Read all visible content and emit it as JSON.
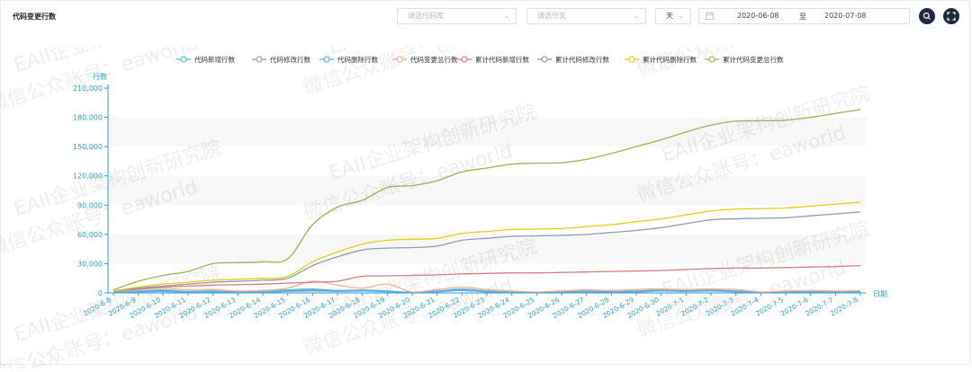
{
  "header": {
    "title": "代码变更行数",
    "repo_placeholder": "请选代码库",
    "branch_placeholder": "请选分支",
    "unit_value": "天",
    "date_start": "2020-06-08",
    "date_separator": "至",
    "date_end": "2020-07-08"
  },
  "colors": {
    "axis": "#2a9dd6",
    "grid_band": "#f7f7f7",
    "series": [
      "#44c7c9",
      "#9a8fd0",
      "#5ab1ef",
      "#f5b08c",
      "#d87a80",
      "#8d98b3",
      "#e5cf0d",
      "#97b552"
    ]
  },
  "chart_data": {
    "type": "line",
    "title": "",
    "xlabel": "日期",
    "ylabel": "行数",
    "ylim": [
      0,
      210000
    ],
    "yticks": [
      0,
      30000,
      60000,
      90000,
      120000,
      150000,
      180000,
      210000
    ],
    "ytick_labels": [
      "0",
      "30,000",
      "60,000",
      "90,000",
      "120,000",
      "150,000",
      "180,000",
      "210,000"
    ],
    "legend_position": "top",
    "grid": true,
    "categories": [
      "2020-6-8",
      "2020-6-9",
      "2020-6-10",
      "2020-6-11",
      "2020-6-12",
      "2020-6-13",
      "2020-6-14",
      "2020-6-15",
      "2020-6-16",
      "2020-6-17",
      "2020-6-18",
      "2020-6-19",
      "2020-6-20",
      "2020-6-21",
      "2020-6-22",
      "2020-6-23",
      "2020-6-24",
      "2020-6-25",
      "2020-6-26",
      "2020-6-27",
      "2020-6-28",
      "2020-6-29",
      "2020-6-30",
      "2020-7-1",
      "2020-7-2",
      "2020-7-3",
      "2020-7-4",
      "2020-7-5",
      "2020-7-6",
      "2020-7-7",
      "2020-7-8"
    ],
    "series": [
      {
        "name": "代码新增行数",
        "values": [
          1000,
          2000,
          3000,
          1500,
          2000,
          1000,
          1500,
          3000,
          4000,
          2500,
          3000,
          2000,
          500,
          2000,
          4000,
          2000,
          1000,
          500,
          1000,
          2000,
          1500,
          2000,
          3000,
          2500,
          3000,
          2000,
          500,
          1000,
          1500,
          1000,
          1500
        ]
      },
      {
        "name": "代码修改行数",
        "values": [
          500,
          1500,
          2000,
          1000,
          1500,
          1000,
          1000,
          2000,
          3000,
          2000,
          2500,
          1500,
          500,
          1500,
          3000,
          1500,
          800,
          300,
          800,
          1500,
          1200,
          1500,
          2500,
          2000,
          2500,
          1500,
          300,
          800,
          1200,
          800,
          1000
        ]
      },
      {
        "name": "代码删除行数",
        "values": [
          300,
          1000,
          1500,
          800,
          1000,
          500,
          800,
          1500,
          2000,
          1500,
          2000,
          1000,
          300,
          1000,
          2500,
          1000,
          500,
          200,
          500,
          1000,
          800,
          1000,
          2000,
          1500,
          2000,
          1000,
          200,
          500,
          800,
          500,
          800
        ]
      },
      {
        "name": "代码变更总行数",
        "values": [
          1500,
          3500,
          5000,
          3000,
          3500,
          2000,
          2500,
          5000,
          12000,
          8000,
          5000,
          9000,
          1000,
          3500,
          6000,
          3500,
          2000,
          1000,
          2000,
          3000,
          2500,
          3500,
          4000,
          3500,
          4000,
          3500,
          1000,
          2000,
          2500,
          2000,
          2500
        ]
      },
      {
        "name": "累计代码新增行数",
        "values": [
          2000,
          4000,
          6000,
          7000,
          8000,
          8500,
          9000,
          10000,
          11000,
          12000,
          17000,
          17500,
          18000,
          18500,
          19500,
          20000,
          20500,
          20500,
          21000,
          21500,
          22000,
          22500,
          23000,
          24000,
          25000,
          25500,
          25500,
          26000,
          26500,
          27000,
          28000
        ]
      },
      {
        "name": "累计代码修改行数",
        "values": [
          1500,
          5000,
          7000,
          9000,
          11000,
          12000,
          13000,
          15000,
          28000,
          37000,
          44000,
          46000,
          46500,
          48000,
          54000,
          56000,
          58000,
          58500,
          59000,
          60000,
          62000,
          64000,
          67000,
          71000,
          75000,
          76000,
          76500,
          77000,
          79000,
          81000,
          83000
        ]
      },
      {
        "name": "累计代码删除行数",
        "values": [
          2000,
          6000,
          9000,
          11000,
          13000,
          14000,
          15000,
          17000,
          32000,
          42000,
          50000,
          54000,
          55000,
          56000,
          61000,
          63000,
          65000,
          65500,
          66000,
          68000,
          70000,
          73000,
          76000,
          80000,
          84000,
          86000,
          86500,
          87000,
          89000,
          91000,
          93000
        ]
      },
      {
        "name": "累计代码变更总行数",
        "values": [
          3000,
          12000,
          18000,
          22000,
          30000,
          31000,
          32000,
          35000,
          70000,
          88000,
          95000,
          108000,
          110000,
          115000,
          124000,
          128000,
          132000,
          133000,
          133500,
          137000,
          143000,
          150000,
          157000,
          165000,
          172000,
          176000,
          176500,
          177000,
          180000,
          184000,
          188000
        ]
      }
    ]
  },
  "watermark": {
    "line1": "EAII企业架构创新研究院",
    "line2": "微信公众账号：eaworld"
  }
}
